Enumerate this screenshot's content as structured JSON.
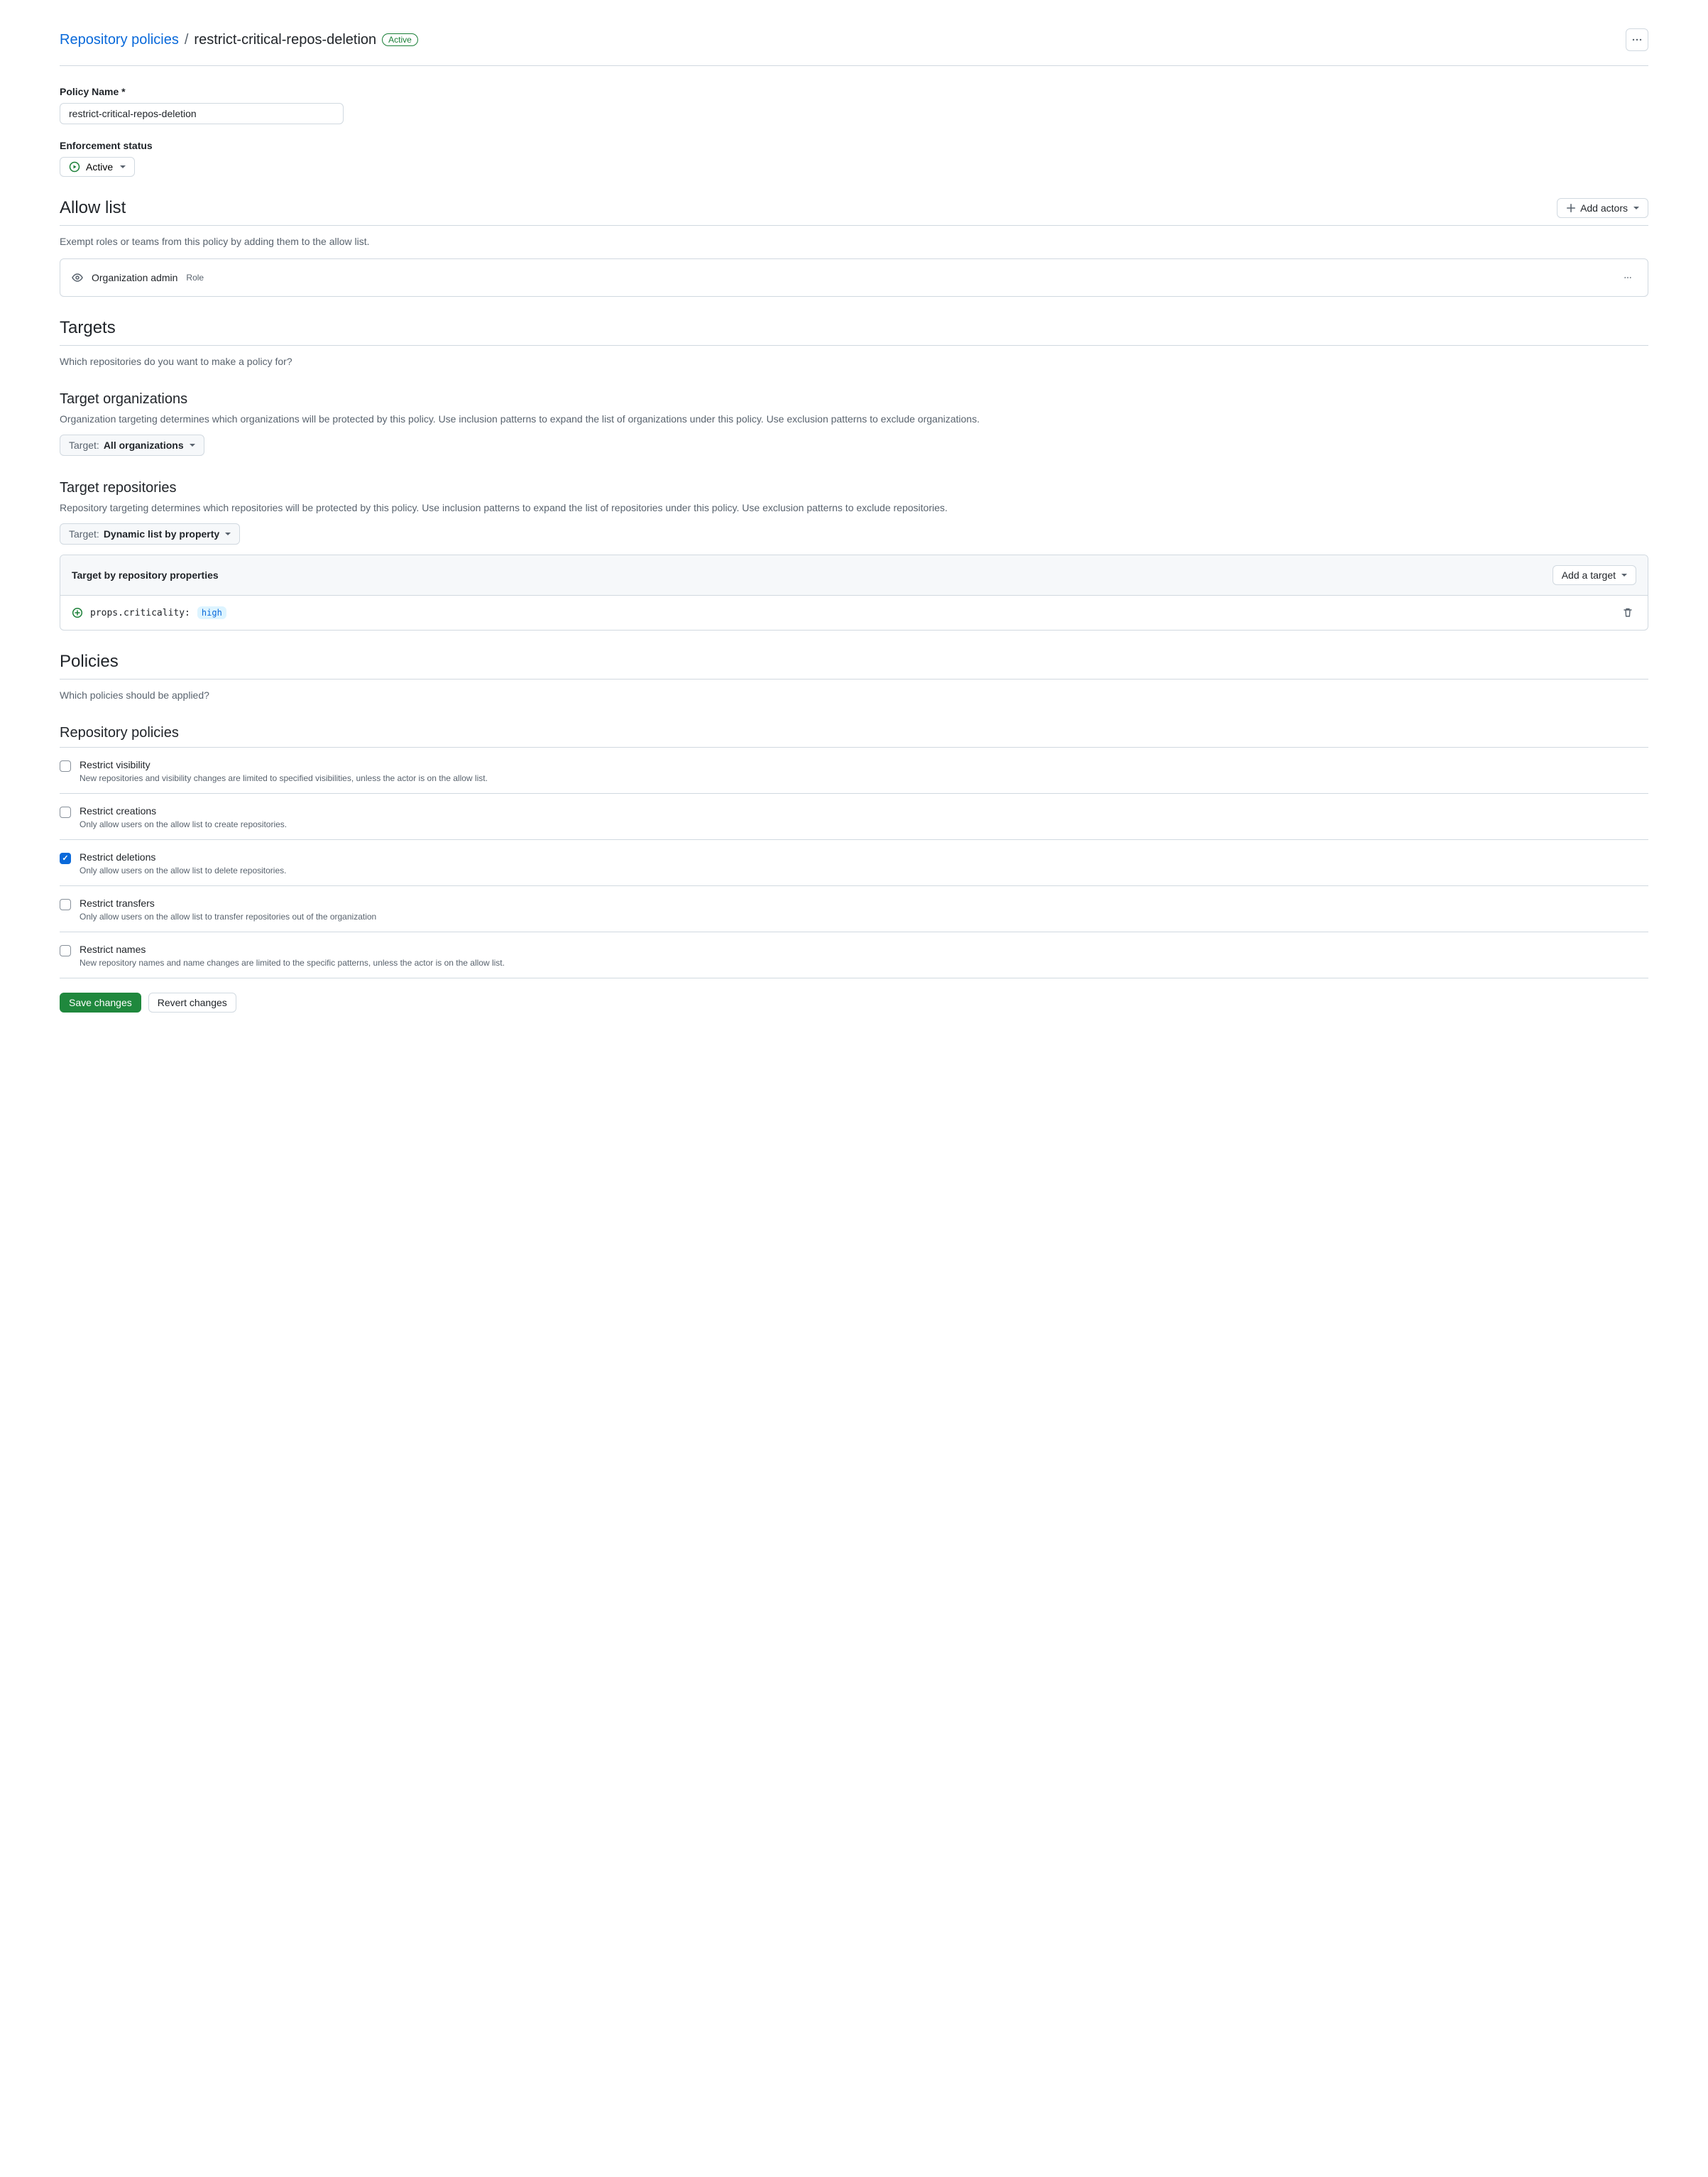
{
  "breadcrumb": {
    "root": "Repository policies",
    "current": "restrict-critical-repos-deletion",
    "status_badge": "Active"
  },
  "policy_name": {
    "label": "Policy Name *",
    "value": "restrict-critical-repos-deletion"
  },
  "enforcement": {
    "label": "Enforcement status",
    "value": "Active"
  },
  "allow_list": {
    "heading": "Allow list",
    "add_button": "Add actors",
    "description": "Exempt roles or teams from this policy by adding them to the allow list.",
    "items": [
      {
        "name": "Organization admin",
        "type": "Role"
      }
    ]
  },
  "targets": {
    "heading": "Targets",
    "description": "Which repositories do you want to make a policy for?",
    "orgs": {
      "heading": "Target organizations",
      "description": "Organization targeting determines which organizations will be protected by this policy. Use inclusion patterns to expand the list of organizations under this policy. Use exclusion patterns to exclude organizations.",
      "target_label": "Target: ",
      "target_value": "All organizations"
    },
    "repos": {
      "heading": "Target repositories",
      "description": "Repository targeting determines which repositories will be protected by this policy. Use inclusion patterns to expand the list of repositories under this policy. Use exclusion patterns to exclude repositories.",
      "target_label": "Target: ",
      "target_value": "Dynamic list by property",
      "property_box_title": "Target by repository properties",
      "add_target_button": "Add a target",
      "property_key": "props.criticality:",
      "property_value": "high"
    }
  },
  "policies": {
    "heading": "Policies",
    "description": "Which policies should be applied?",
    "subheading": "Repository policies",
    "items": [
      {
        "title": "Restrict visibility",
        "desc": "New repositories and visibility changes are limited to specified visibilities, unless the actor is on the allow list.",
        "checked": false
      },
      {
        "title": "Restrict creations",
        "desc": "Only allow users on the allow list to create repositories.",
        "checked": false
      },
      {
        "title": "Restrict deletions",
        "desc": "Only allow users on the allow list to delete repositories.",
        "checked": true
      },
      {
        "title": "Restrict transfers",
        "desc": "Only allow users on the allow list to transfer repositories out of the organization",
        "checked": false
      },
      {
        "title": "Restrict names",
        "desc": "New repository names and name changes are limited to the specific patterns, unless the actor is on the allow list.",
        "checked": false
      }
    ]
  },
  "footer": {
    "save": "Save changes",
    "revert": "Revert changes"
  }
}
